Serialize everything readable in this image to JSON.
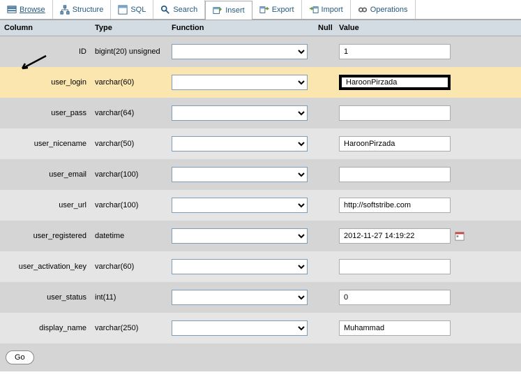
{
  "tabs": [
    {
      "label": "Browse",
      "icon": "browse"
    },
    {
      "label": "Structure",
      "icon": "structure"
    },
    {
      "label": "SQL",
      "icon": "sql"
    },
    {
      "label": "Search",
      "icon": "search"
    },
    {
      "label": "Insert",
      "icon": "insert"
    },
    {
      "label": "Export",
      "icon": "export"
    },
    {
      "label": "Import",
      "icon": "import"
    },
    {
      "label": "Operations",
      "icon": "operations"
    }
  ],
  "active_tab_index": 4,
  "headers": {
    "col": "Column",
    "type": "Type",
    "func": "Function",
    "null": "Null",
    "value": "Value"
  },
  "rows": [
    {
      "col": "ID",
      "type": "bigint(20) unsigned",
      "value": "1",
      "short": true
    },
    {
      "col": "user_login",
      "type": "varchar(60)",
      "value": "HaroonPirzada",
      "highlight": true,
      "short": true
    },
    {
      "col": "user_pass",
      "type": "varchar(64)",
      "value": ""
    },
    {
      "col": "user_nicename",
      "type": "varchar(50)",
      "value": "HaroonPirzada"
    },
    {
      "col": "user_email",
      "type": "varchar(100)",
      "value": ""
    },
    {
      "col": "user_url",
      "type": "varchar(100)",
      "value": "http://softstribe.com"
    },
    {
      "col": "user_registered",
      "type": "datetime",
      "value": "2012-11-27 14:19:22",
      "calendar": true,
      "short": true
    },
    {
      "col": "user_activation_key",
      "type": "varchar(60)",
      "value": ""
    },
    {
      "col": "user_status",
      "type": "int(11)",
      "value": "0",
      "short": true
    },
    {
      "col": "display_name",
      "type": "varchar(250)",
      "value": "Muhammad"
    }
  ],
  "buttons": {
    "go": "Go"
  }
}
